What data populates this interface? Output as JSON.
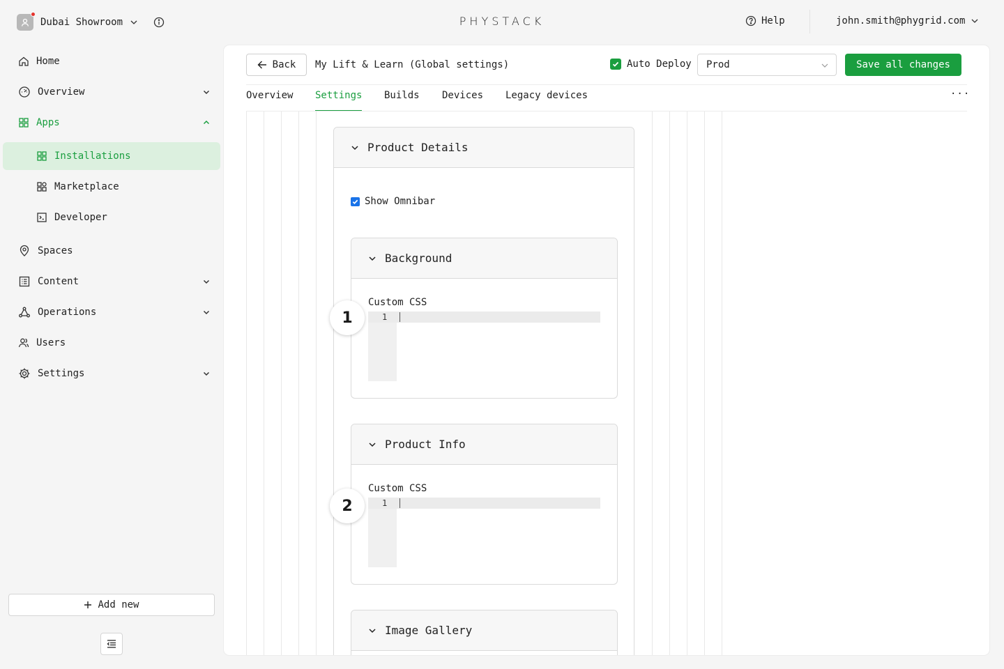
{
  "topbar": {
    "workspace": "Dubai Showroom",
    "logo": "PHYSTACK",
    "help": "Help",
    "user_email": "john.smith@phygrid.com"
  },
  "sidebar": {
    "home": "Home",
    "overview": "Overview",
    "apps": "Apps",
    "installations": "Installations",
    "marketplace": "Marketplace",
    "developer": "Developer",
    "spaces": "Spaces",
    "content": "Content",
    "operations": "Operations",
    "users": "Users",
    "settings": "Settings",
    "add_new": "Add new"
  },
  "header": {
    "back": "Back",
    "title": "My Lift & Learn (Global settings)",
    "auto_deploy": "Auto Deploy",
    "auto_deploy_checked": true,
    "environment": "Prod",
    "save": "Save all changes"
  },
  "tabs": [
    "Overview",
    "Settings",
    "Builds",
    "Devices",
    "Legacy devices"
  ],
  "active_tab": "Settings",
  "content": {
    "product_details": "Product Details",
    "show_omnibar": "Show Omnibar",
    "show_omnibar_checked": true,
    "background": {
      "title": "Background",
      "field_label": "Custom CSS",
      "line_number": "1"
    },
    "product_info": {
      "title": "Product Info",
      "field_label": "Custom CSS",
      "line_number": "1"
    },
    "image_gallery": "Image Gallery"
  },
  "badges": [
    "1",
    "2"
  ],
  "colors": {
    "accent": "#1a9e3f",
    "accent_light": "#dcf0df",
    "checkbox_blue": "#1a73e8"
  }
}
